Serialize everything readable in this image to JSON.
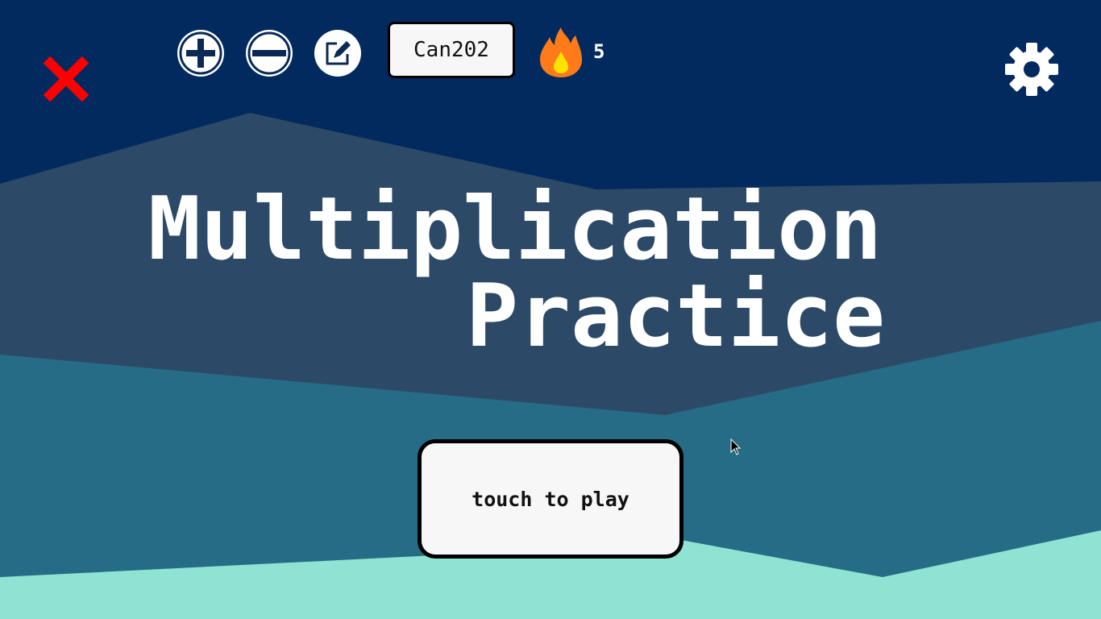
{
  "colors": {
    "sky": "#022a5e",
    "mountain": "#2c4a67",
    "hills": "#266c86",
    "ground": "#8fe3d2",
    "close_red": "#ff0000",
    "flame_outer": "#ff7b1a",
    "flame_inner": "#ffe100",
    "icon_navy": "#0a2a55"
  },
  "toolbar": {
    "close_icon": "close-x-icon",
    "add_icon": "plus-circle-icon",
    "remove_icon": "minus-circle-icon",
    "edit_icon": "edit-icon",
    "username": "Can202",
    "streak_icon": "flame-icon",
    "streak_count": "5",
    "settings_icon": "gear-icon"
  },
  "title": {
    "line1": "Multiplication",
    "line2": "Practice"
  },
  "play_button": {
    "label": "touch to play"
  }
}
